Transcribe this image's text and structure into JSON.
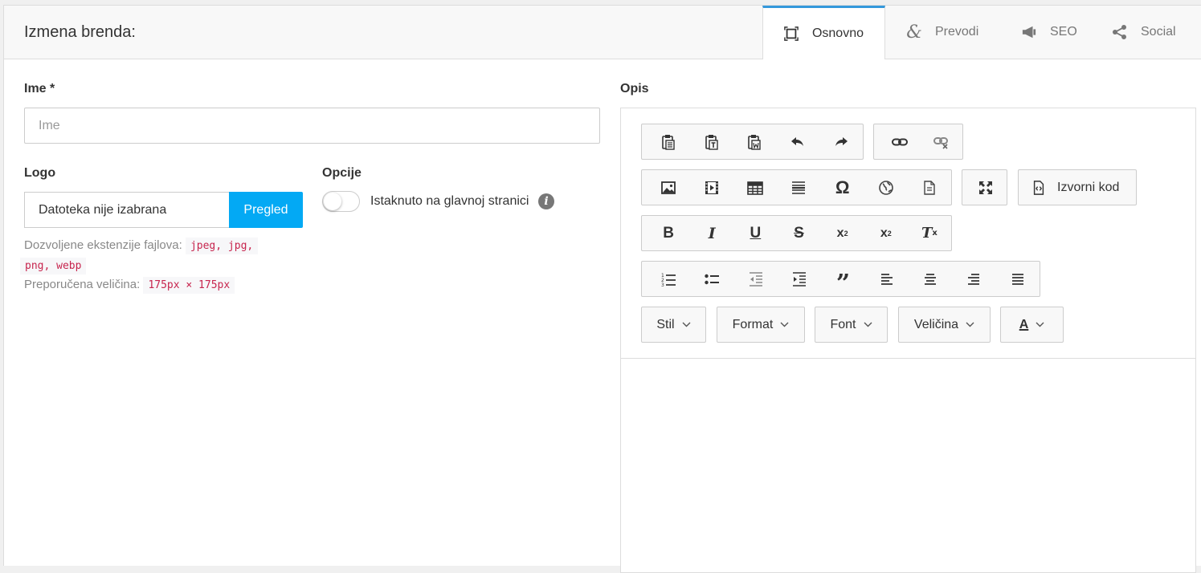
{
  "header": {
    "title": "Izmena brenda:",
    "tabs": [
      {
        "label": "Osnovno",
        "icon": "frame-icon",
        "active": true
      },
      {
        "label": "Prevodi",
        "icon": "ampersand-icon",
        "active": false
      },
      {
        "label": "SEO",
        "icon": "megaphone-icon",
        "active": false
      },
      {
        "label": "Social",
        "icon": "share-icon",
        "active": false
      }
    ]
  },
  "form": {
    "ime_label": "Ime *",
    "ime_placeholder": "Ime",
    "logo_label": "Logo",
    "file_status": "Datoteka nije izabrana",
    "browse_label": "Pregled",
    "allowed_ext_label": "Dozvoljene ekstenzije fajlova:",
    "allowed_ext_1": "jpeg, jpg,",
    "allowed_ext_2": "png, webp",
    "recommended_size_label": "Preporučena veličina:",
    "recommended_size": "175px × 175px",
    "options_label": "Opcije",
    "featured_label": "Istaknuto na glavnoj stranici",
    "featured_on": false,
    "description_label": "Opis"
  },
  "editor": {
    "source_label": "Izvorni kod",
    "dropdowns": {
      "style": "Stil",
      "format": "Format",
      "font": "Font",
      "size": "Veličina",
      "text_color": "A"
    }
  },
  "colors": {
    "accent": "#3498db",
    "browse_button": "#03a9f4",
    "code_text": "#c7254e"
  }
}
